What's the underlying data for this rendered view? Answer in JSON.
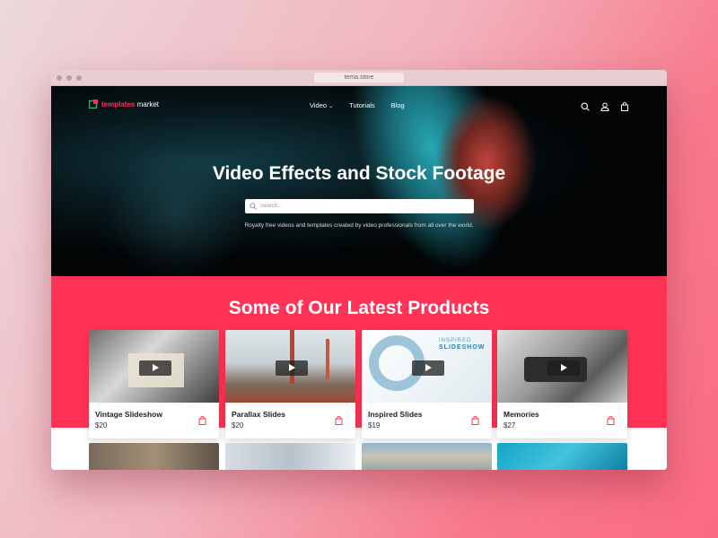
{
  "browser": {
    "url": "tema.store"
  },
  "logo": {
    "brand": "templates",
    "suffix": " market"
  },
  "nav": {
    "links": [
      {
        "label": "Video"
      },
      {
        "label": "Tutorials"
      },
      {
        "label": "Blog"
      }
    ],
    "icons": [
      "search-icon",
      "account-icon",
      "cart-icon"
    ]
  },
  "hero": {
    "title": "Video Effects and Stock Footage",
    "search_placeholder": "Search...",
    "subtitle": "Royalty free videos and templates created by video professionals from all over the world."
  },
  "products": {
    "title": "Some of Our Latest Products",
    "items": [
      {
        "name": "Vintage Slideshow",
        "price": "$20"
      },
      {
        "name": "Parallax Slides",
        "price": "$20"
      },
      {
        "name": "Inspired Slides",
        "price": "$19"
      },
      {
        "name": "Memories",
        "price": "$27"
      }
    ],
    "thumb_text": {
      "inspired_line1": "INSPIRED",
      "inspired_line2": "SLIDESHOW"
    }
  },
  "colors": {
    "accent": "#ff3356",
    "hero_bg": "#000000",
    "card_text": "#222222"
  }
}
